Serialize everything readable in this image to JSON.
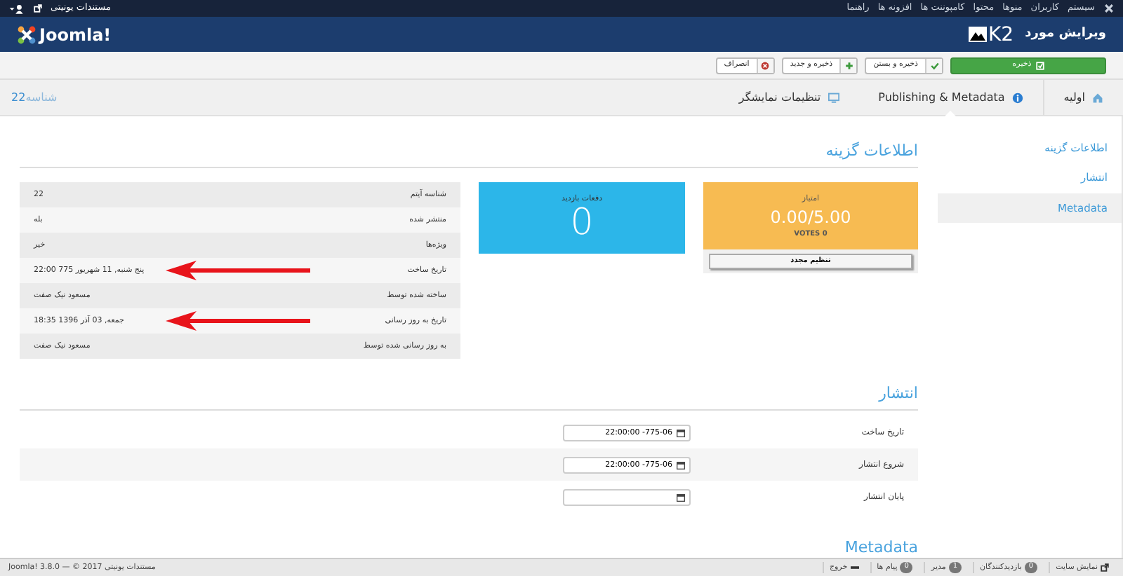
{
  "top_menu": {
    "items": [
      "سیستم",
      "کاربران",
      "منوها",
      "محتوا",
      "کامپوننت ها",
      "افزونه ها",
      "راهنما"
    ],
    "site_link": "مستندات یونیتی"
  },
  "header": {
    "title": "ویرایش مورد",
    "k2_logo": "K2",
    "brand": "Joomla!"
  },
  "toolbar": [
    {
      "label": "ذخیره",
      "kind": "save"
    },
    {
      "label": "ذخیره و بستن",
      "kind": "check"
    },
    {
      "label": "ذخیره و جدید",
      "kind": "new"
    },
    {
      "label": "انصراف",
      "kind": "cancel"
    }
  ],
  "tabs": [
    {
      "label": "اولیه",
      "kind": "home",
      "selected": false
    },
    {
      "label": "Publishing & Metadata",
      "kind": "info",
      "selected": true
    },
    {
      "label": "تنظیمات نمایشگر",
      "kind": "display",
      "selected": false
    }
  ],
  "item_id": {
    "label": "شناسه",
    "value": "22"
  },
  "sidebar": {
    "items": [
      {
        "label": "اطلاعات گزینه",
        "selected": false
      },
      {
        "label": "انتشار",
        "selected": false
      },
      {
        "label": "Metadata",
        "selected": true
      }
    ]
  },
  "item_info": {
    "heading": "اطلاعات گزینه",
    "rating": {
      "label": "امتیاز",
      "value": "0.00/5.00",
      "votes": "VOTES 0",
      "reset_button": "تنظیم مجدد"
    },
    "hits": {
      "label": "دفعات بازدید",
      "value": "0"
    },
    "rows": [
      {
        "label": "شناسه آیتم",
        "value": "22",
        "arrow": false
      },
      {
        "label": "منتشر شده",
        "value": "بله",
        "arrow": false
      },
      {
        "label": "ویژه‌ها",
        "value": "خیر",
        "arrow": false
      },
      {
        "label": "تاریخ ساخت",
        "value": "پنج شنبه, 11 شهریور 775 22:00",
        "arrow": true
      },
      {
        "label": "ساخته شده توسط",
        "value": "مسعود نیک صفت",
        "arrow": false
      },
      {
        "label": "تاریخ به روز رسانی",
        "value": "جمعه, 03 آذر 1396 18:35",
        "arrow": true
      },
      {
        "label": "به روز رسانی شده توسط",
        "value": "مسعود نیک صفت",
        "arrow": false
      }
    ]
  },
  "publishing": {
    "heading": "انتشار",
    "fields": [
      {
        "label": "تاریخ ساخت",
        "value": "775-06- 22:00:00"
      },
      {
        "label": "شروع انتشار",
        "value": "775-06- 22:00:00"
      },
      {
        "label": "پایان انتشار"
      }
    ]
  },
  "metadata": {
    "heading": "Metadata"
  },
  "footer": {
    "items": [
      {
        "label": "نمایش سایت",
        "kind": "link"
      },
      {
        "label": "بازدیدکنندگان",
        "count": "0",
        "kind": "badge"
      },
      {
        "label": "مدیر",
        "count": "1",
        "kind": "badge"
      },
      {
        "label": "پیام ها",
        "count": "0",
        "kind": "badge"
      },
      {
        "label": "خروج",
        "kind": "logout"
      }
    ],
    "copyright": "مستندات یونیتی Joomla! 3.8.0 — © 2017"
  }
}
